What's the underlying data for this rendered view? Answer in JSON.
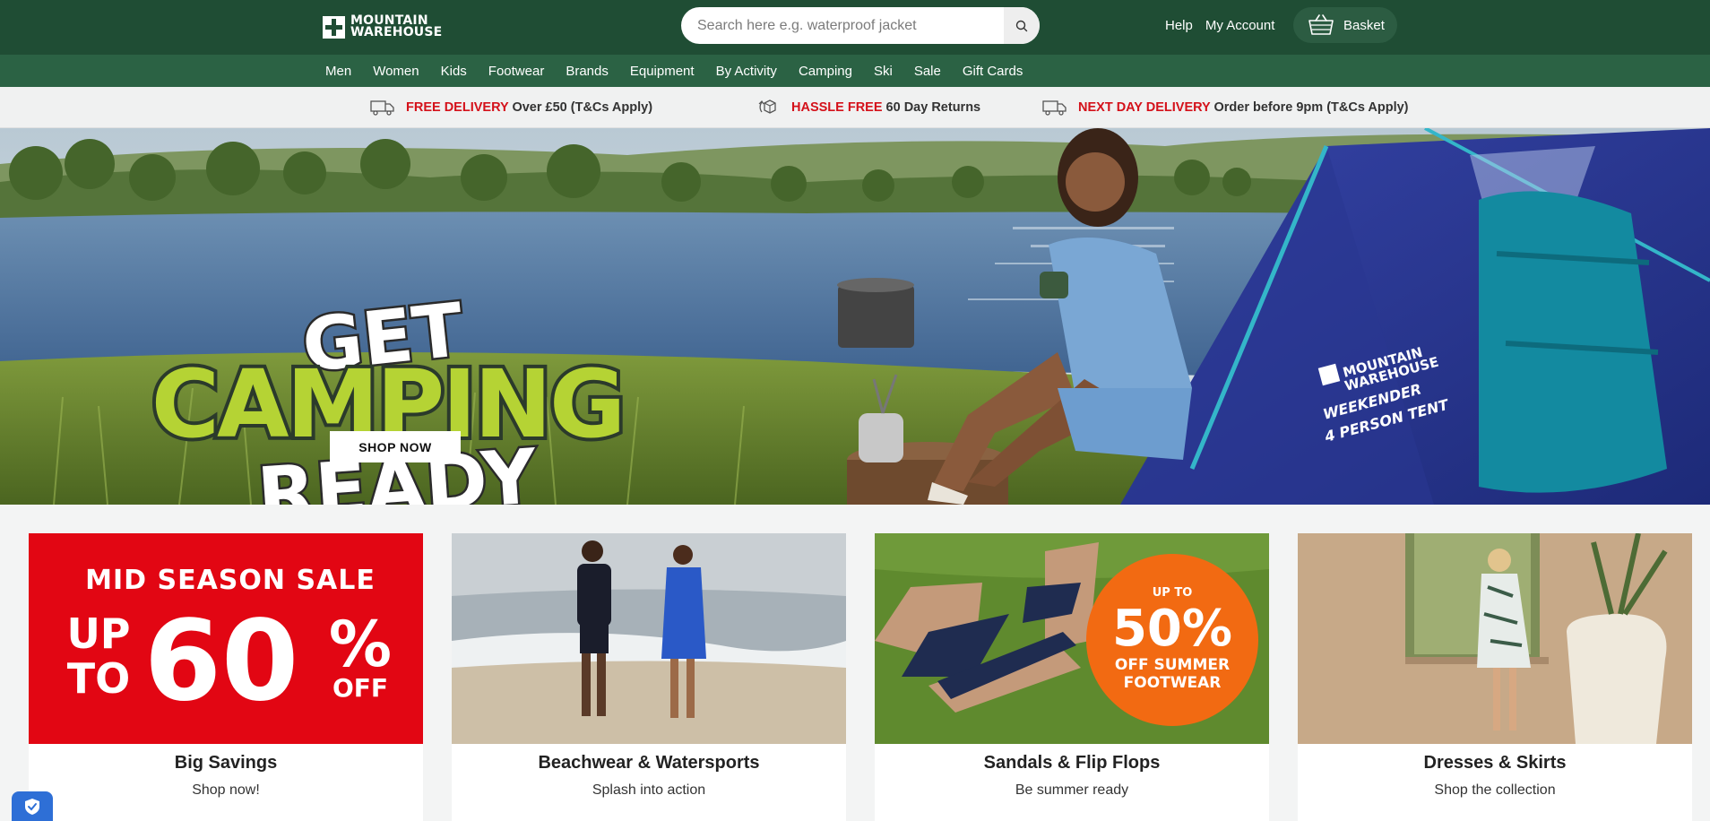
{
  "header": {
    "logo_line1": "MOUNTAIN",
    "logo_line2": "WAREHOUSE",
    "search_placeholder": "Search here e.g. waterproof jacket",
    "help": "Help",
    "my_account": "My Account",
    "basket": "Basket"
  },
  "nav": {
    "items": [
      "Men",
      "Women",
      "Kids",
      "Footwear",
      "Brands",
      "Equipment",
      "By Activity",
      "Camping",
      "Ski",
      "Sale",
      "Gift Cards"
    ]
  },
  "promo": {
    "delivery_red": "FREE DELIVERY",
    "delivery_text": "Over £50  (T&Cs Apply)",
    "returns_red": "HASSLE FREE",
    "returns_text": "60 Day Returns",
    "nextday_red": "NEXT DAY DELIVERY",
    "nextday_text": "Order before 9pm (T&Cs Apply)"
  },
  "hero": {
    "line1": "GET",
    "line2": "CAMPING",
    "line3": "READY",
    "cta": "SHOP NOW",
    "tent_brand1": "MOUNTAIN",
    "tent_brand2": "WAREHOUSE",
    "tent_model1": "WEEKENDER",
    "tent_model2": "4 PERSON TENT"
  },
  "cards": [
    {
      "title": "Big Savings",
      "subtitle": "Shop now!",
      "img_line1": "MID SEASON SALE",
      "img_up": "UP",
      "img_to": "TO",
      "img_value": "60",
      "img_pct": "%",
      "img_off": "OFF"
    },
    {
      "title": "Beachwear & Watersports",
      "subtitle": "Splash into action"
    },
    {
      "title": "Sandals & Flip Flops",
      "subtitle": "Be summer ready",
      "badge_upto": "UP TO",
      "badge_value": "50%",
      "badge_line1": "OFF SUMMER",
      "badge_line2": "FOOTWEAR"
    },
    {
      "title": "Dresses & Skirts",
      "subtitle": "Shop the collection"
    }
  ],
  "colors": {
    "header_bg": "#1f4d34",
    "nav_bg": "#2b6244",
    "promo_red": "#d4111a",
    "sale_red": "#e20613",
    "badge_orange": "#f26a12",
    "hero_green": "#b5d334"
  }
}
